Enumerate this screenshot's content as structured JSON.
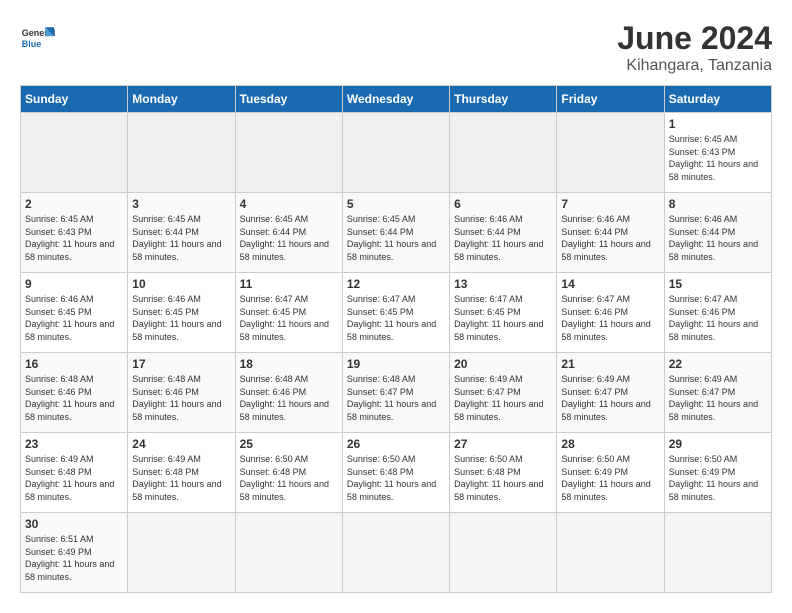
{
  "logo": {
    "text_general": "General",
    "text_blue": "Blue"
  },
  "title": {
    "month_year": "June 2024",
    "location": "Kihangara, Tanzania"
  },
  "weekdays": [
    "Sunday",
    "Monday",
    "Tuesday",
    "Wednesday",
    "Thursday",
    "Friday",
    "Saturday"
  ],
  "weeks": [
    [
      {
        "day": "",
        "empty": true
      },
      {
        "day": "",
        "empty": true
      },
      {
        "day": "",
        "empty": true
      },
      {
        "day": "",
        "empty": true
      },
      {
        "day": "",
        "empty": true
      },
      {
        "day": "",
        "empty": true
      },
      {
        "day": "1",
        "sunrise": "6:45 AM",
        "sunset": "6:43 PM",
        "daylight": "11 hours and 58 minutes."
      }
    ],
    [
      {
        "day": "2",
        "sunrise": "6:45 AM",
        "sunset": "6:43 PM",
        "daylight": "11 hours and 58 minutes."
      },
      {
        "day": "3",
        "sunrise": "6:45 AM",
        "sunset": "6:44 PM",
        "daylight": "11 hours and 58 minutes."
      },
      {
        "day": "4",
        "sunrise": "6:45 AM",
        "sunset": "6:44 PM",
        "daylight": "11 hours and 58 minutes."
      },
      {
        "day": "5",
        "sunrise": "6:45 AM",
        "sunset": "6:44 PM",
        "daylight": "11 hours and 58 minutes."
      },
      {
        "day": "6",
        "sunrise": "6:46 AM",
        "sunset": "6:44 PM",
        "daylight": "11 hours and 58 minutes."
      },
      {
        "day": "7",
        "sunrise": "6:46 AM",
        "sunset": "6:44 PM",
        "daylight": "11 hours and 58 minutes."
      },
      {
        "day": "8",
        "sunrise": "6:46 AM",
        "sunset": "6:44 PM",
        "daylight": "11 hours and 58 minutes."
      }
    ],
    [
      {
        "day": "9",
        "sunrise": "6:46 AM",
        "sunset": "6:45 PM",
        "daylight": "11 hours and 58 minutes."
      },
      {
        "day": "10",
        "sunrise": "6:46 AM",
        "sunset": "6:45 PM",
        "daylight": "11 hours and 58 minutes."
      },
      {
        "day": "11",
        "sunrise": "6:47 AM",
        "sunset": "6:45 PM",
        "daylight": "11 hours and 58 minutes."
      },
      {
        "day": "12",
        "sunrise": "6:47 AM",
        "sunset": "6:45 PM",
        "daylight": "11 hours and 58 minutes."
      },
      {
        "day": "13",
        "sunrise": "6:47 AM",
        "sunset": "6:45 PM",
        "daylight": "11 hours and 58 minutes."
      },
      {
        "day": "14",
        "sunrise": "6:47 AM",
        "sunset": "6:46 PM",
        "daylight": "11 hours and 58 minutes."
      },
      {
        "day": "15",
        "sunrise": "6:47 AM",
        "sunset": "6:46 PM",
        "daylight": "11 hours and 58 minutes."
      }
    ],
    [
      {
        "day": "16",
        "sunrise": "6:48 AM",
        "sunset": "6:46 PM",
        "daylight": "11 hours and 58 minutes."
      },
      {
        "day": "17",
        "sunrise": "6:48 AM",
        "sunset": "6:46 PM",
        "daylight": "11 hours and 58 minutes."
      },
      {
        "day": "18",
        "sunrise": "6:48 AM",
        "sunset": "6:46 PM",
        "daylight": "11 hours and 58 minutes."
      },
      {
        "day": "19",
        "sunrise": "6:48 AM",
        "sunset": "6:47 PM",
        "daylight": "11 hours and 58 minutes."
      },
      {
        "day": "20",
        "sunrise": "6:49 AM",
        "sunset": "6:47 PM",
        "daylight": "11 hours and 58 minutes."
      },
      {
        "day": "21",
        "sunrise": "6:49 AM",
        "sunset": "6:47 PM",
        "daylight": "11 hours and 58 minutes."
      },
      {
        "day": "22",
        "sunrise": "6:49 AM",
        "sunset": "6:47 PM",
        "daylight": "11 hours and 58 minutes."
      }
    ],
    [
      {
        "day": "23",
        "sunrise": "6:49 AM",
        "sunset": "6:48 PM",
        "daylight": "11 hours and 58 minutes."
      },
      {
        "day": "24",
        "sunrise": "6:49 AM",
        "sunset": "6:48 PM",
        "daylight": "11 hours and 58 minutes."
      },
      {
        "day": "25",
        "sunrise": "6:50 AM",
        "sunset": "6:48 PM",
        "daylight": "11 hours and 58 minutes."
      },
      {
        "day": "26",
        "sunrise": "6:50 AM",
        "sunset": "6:48 PM",
        "daylight": "11 hours and 58 minutes."
      },
      {
        "day": "27",
        "sunrise": "6:50 AM",
        "sunset": "6:48 PM",
        "daylight": "11 hours and 58 minutes."
      },
      {
        "day": "28",
        "sunrise": "6:50 AM",
        "sunset": "6:49 PM",
        "daylight": "11 hours and 58 minutes."
      },
      {
        "day": "29",
        "sunrise": "6:50 AM",
        "sunset": "6:49 PM",
        "daylight": "11 hours and 58 minutes."
      }
    ],
    [
      {
        "day": "30",
        "sunrise": "6:51 AM",
        "sunset": "6:49 PM",
        "daylight": "11 hours and 58 minutes."
      },
      {
        "day": "",
        "empty": true
      },
      {
        "day": "",
        "empty": true
      },
      {
        "day": "",
        "empty": true
      },
      {
        "day": "",
        "empty": true
      },
      {
        "day": "",
        "empty": true
      },
      {
        "day": "",
        "empty": true
      }
    ]
  ]
}
